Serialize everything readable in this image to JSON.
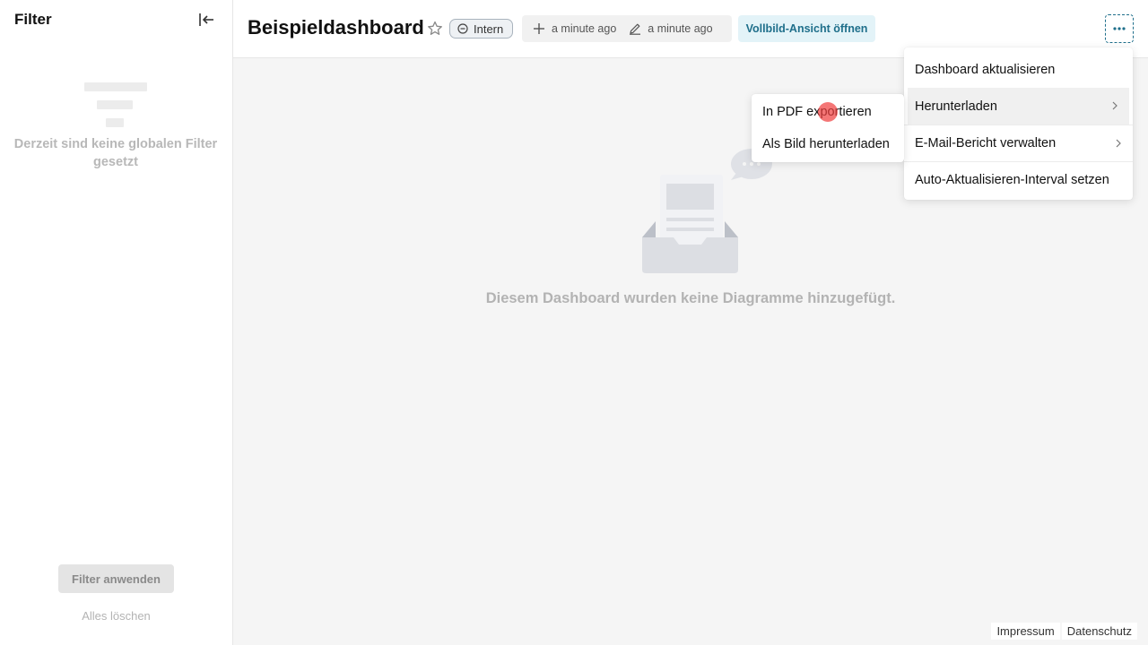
{
  "sidebar": {
    "title": "Filter",
    "empty_text": "Derzeit sind keine globalen Filter gesetzt",
    "apply_label": "Filter anwenden",
    "clear_label": "Alles löschen"
  },
  "header": {
    "title": "Beispieldashboard",
    "badge": "Intern",
    "created": "a minute ago",
    "modified": "a minute ago",
    "fullscreen_label": "Vollbild-Ansicht öffnen"
  },
  "main": {
    "empty_text": "Diesem Dashboard wurden keine Diagramme hinzugefügt."
  },
  "menu": {
    "items": [
      {
        "label": "Dashboard aktualisieren"
      },
      {
        "label": "Herunterladen"
      },
      {
        "label": "E-Mail-Bericht verwalten"
      },
      {
        "label": "Auto-Aktualisieren-Interval setzen"
      }
    ],
    "submenu": [
      {
        "label": "In PDF exportieren"
      },
      {
        "label": "Als Bild herunterladen"
      }
    ]
  },
  "footer": {
    "impressum": "Impressum",
    "datenschutz": "Datenschutz"
  },
  "colors": {
    "accent": "#1f6f8b",
    "fullscreen_bg": "#e3f3f8",
    "main_bg": "#f5f5f5"
  }
}
